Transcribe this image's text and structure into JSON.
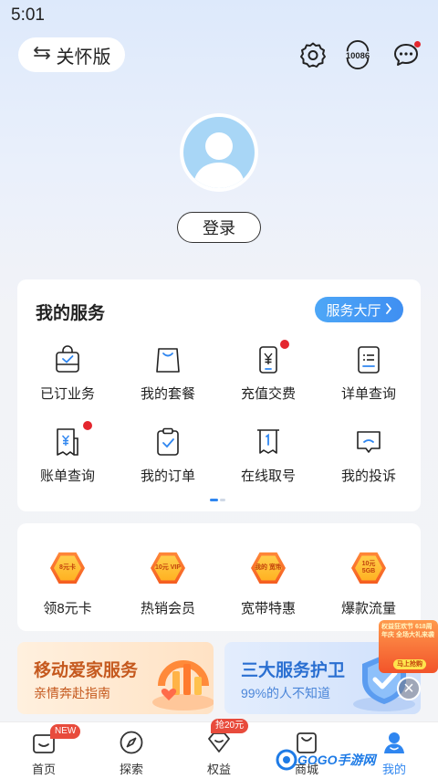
{
  "status_bar": {
    "time": "5:01"
  },
  "header": {
    "care_mode_label": "关怀版",
    "care_mode_icon": "swap-arrows-icon",
    "hotline_number": "10086"
  },
  "profile": {
    "login_label": "登录"
  },
  "services": {
    "title": "我的服务",
    "hall_label": "服务大厅",
    "items": [
      {
        "label": "已订业务",
        "icon": "bag-check-icon",
        "dot": false
      },
      {
        "label": "我的套餐",
        "icon": "shopping-bag-icon",
        "dot": false
      },
      {
        "label": "充值交费",
        "icon": "phone-yuan-icon",
        "dot": true
      },
      {
        "label": "详单查询",
        "icon": "list-document-icon",
        "dot": false
      },
      {
        "label": "账单查询",
        "icon": "bill-yuan-icon",
        "dot": true
      },
      {
        "label": "我的订单",
        "icon": "clipboard-check-icon",
        "dot": false
      },
      {
        "label": "在线取号",
        "icon": "queue-ticket-icon",
        "dot": false
      },
      {
        "label": "我的投诉",
        "icon": "complaint-chat-icon",
        "dot": false
      }
    ],
    "page_count": 2,
    "current_page": 1
  },
  "benefits": {
    "items": [
      {
        "label": "领8元卡",
        "badge": "8元卡"
      },
      {
        "label": "热销会员",
        "badge": "10元 VIP"
      },
      {
        "label": "宽带特惠",
        "badge": "我的 宽带"
      },
      {
        "label": "爆款流量",
        "badge": "10元 5GB"
      }
    ]
  },
  "banners": {
    "left": {
      "title": "移动爱家服务",
      "subtitle": "亲情奔赴指南"
    },
    "right": {
      "title": "三大服务护卫",
      "subtitle": "99%的人不知道"
    }
  },
  "float_ad": {
    "text": "权益狂欢节 618周年庆 全场大礼来袭",
    "button": "马上抢购",
    "close": "×"
  },
  "bottom_nav": {
    "items": [
      {
        "label": "首页",
        "badge": "NEW"
      },
      {
        "label": "探索",
        "badge": ""
      },
      {
        "label": "权益",
        "badge": "抢20元"
      },
      {
        "label": "商城",
        "badge": ""
      },
      {
        "label": "我的",
        "badge": ""
      }
    ],
    "active_index": 4
  },
  "watermark": {
    "text": "GOGO手游网"
  },
  "colors": {
    "accent": "#3f8ff2",
    "badge_red": "#e4262e",
    "orange": "#f45b1f"
  }
}
